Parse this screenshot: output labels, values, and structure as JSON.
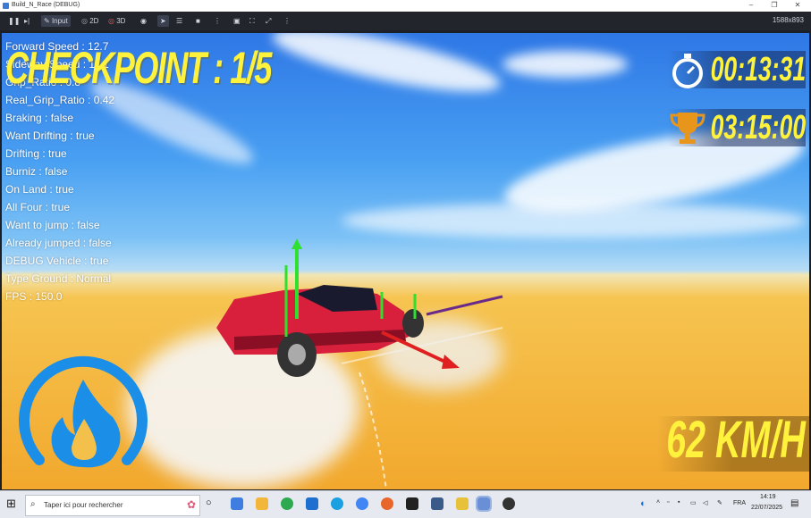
{
  "window": {
    "title": "Build_N_Race (DEBUG)"
  },
  "toolbar": {
    "input_label": "Input",
    "mode_2d": "2D",
    "mode_3d": "3D",
    "resolution": "1588x893"
  },
  "hud": {
    "checkpoint": "CHECKPOINT : 1/5",
    "timer": "00:13:31",
    "best_time": "03:15:00",
    "speed": "62 KM/H"
  },
  "debug": [
    "Forward Speed : 12.7",
    "Sideway Speed : 11.1",
    "Grip_Ratio : 0.8",
    "Real_Grip_Ratio : 0.42",
    "Braking : false",
    "Want Drifting : true",
    "Drifting : true",
    "Burniz : false",
    "On Land : true",
    "All Four : true",
    "Want to jump : false",
    "Already jumped : false",
    "DEBUG Vehicle : true",
    "Type Ground : Normal",
    "FPS : 150.0"
  ],
  "taskbar": {
    "search_placeholder": "Taper ici pour rechercher",
    "language": "FRA",
    "time": "14:19",
    "date": "22/07/2025"
  },
  "colors": {
    "hud_yellow": "#fff23c",
    "flame_blue": "#1b8fe8",
    "car_red": "#d8203c"
  }
}
